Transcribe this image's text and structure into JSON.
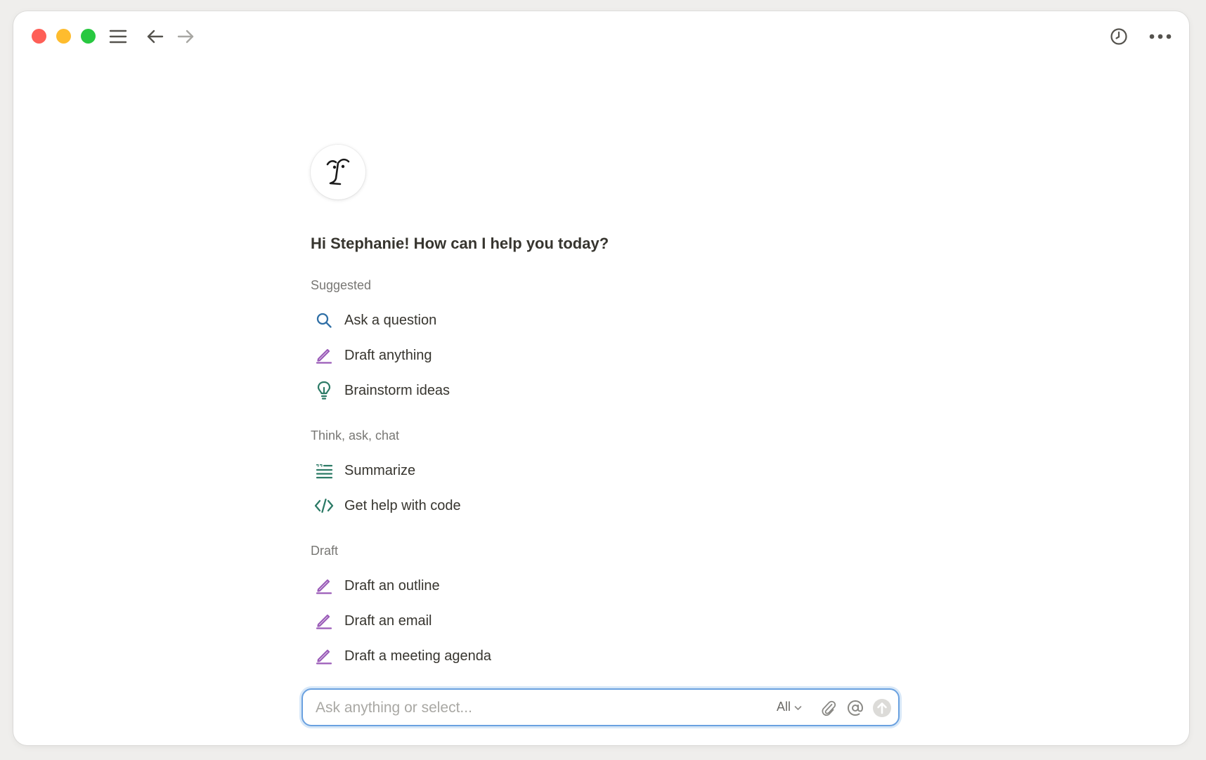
{
  "titlebar": {
    "menu_icon": "hamburger-menu-icon",
    "back_icon": "arrow-left-icon",
    "forward_icon": "arrow-right-icon",
    "history_icon": "clock-icon",
    "more_icon": "more-horizontal-icon"
  },
  "assistant": {
    "avatar_icon": "ai-face-icon",
    "greeting": "Hi Stephanie! How can I help you today?"
  },
  "sections": [
    {
      "label": "Suggested",
      "items": [
        {
          "label": "Ask a question",
          "icon": "search-icon",
          "color": "#2f6fa6"
        },
        {
          "label": "Draft anything",
          "icon": "pen-icon",
          "color": "#9a5bb8"
        },
        {
          "label": "Brainstorm ideas",
          "icon": "lightbulb-icon",
          "color": "#2c7a66"
        }
      ]
    },
    {
      "label": "Think, ask, chat",
      "items": [
        {
          "label": "Summarize",
          "icon": "summary-lines-icon",
          "color": "#2c7a66"
        },
        {
          "label": "Get help with code",
          "icon": "code-icon",
          "color": "#2c7a66"
        }
      ]
    },
    {
      "label": "Draft",
      "items": [
        {
          "label": "Draft an outline",
          "icon": "pen-icon",
          "color": "#9a5bb8"
        },
        {
          "label": "Draft an email",
          "icon": "pen-icon",
          "color": "#9a5bb8"
        },
        {
          "label": "Draft a meeting agenda",
          "icon": "pen-icon",
          "color": "#9a5bb8"
        }
      ]
    }
  ],
  "input": {
    "value": "",
    "placeholder": "Ask anything or select...",
    "scope_label": "All",
    "attach_icon": "paperclip-icon",
    "mention_icon": "at-sign-icon",
    "submit_icon": "arrow-up-circle-icon"
  },
  "colors": {
    "accent_focus": "#6aa1e0",
    "text": "#37352f",
    "muted": "#787774"
  }
}
